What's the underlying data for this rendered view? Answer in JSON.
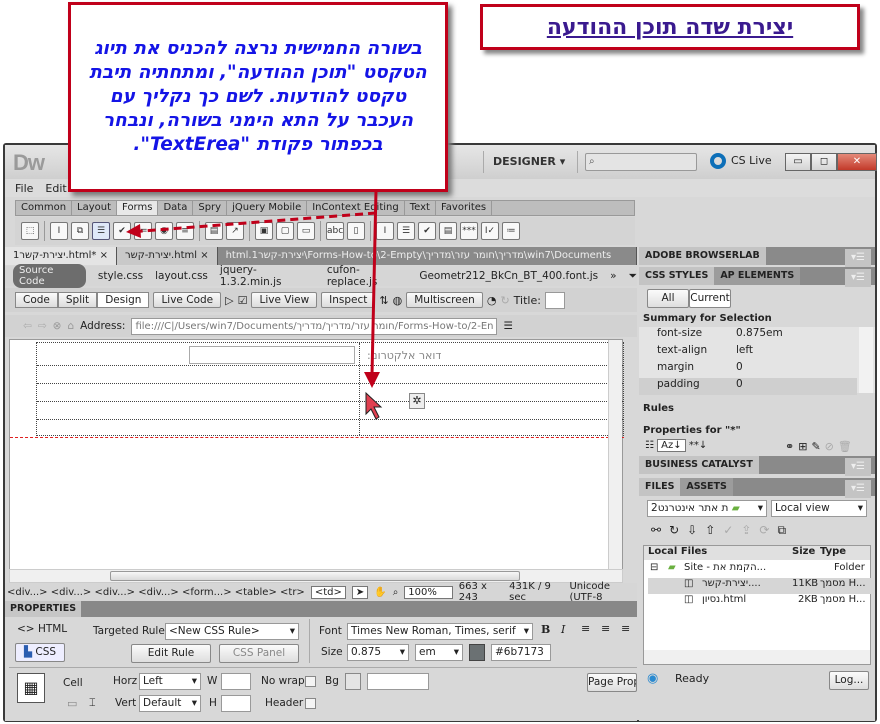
{
  "title_box": {
    "text": "יצירת שדה תוכן ההודעה"
  },
  "callout": {
    "text": "בשורה החמישית נרצה להכניס את תיוג הטקסט \"תוכן ההודעה\", ומתחתיה תיבת טקסט להודעות. לשם כך נקליך עם העכבר על התא הימני בשורה, ונבחר בכפתור פקודת \"TextErea\"."
  },
  "app": {
    "logo": "Dw",
    "workspace": "DESIGNER ▾",
    "cs_live": "CS Live",
    "menu": [
      "File",
      "Edit"
    ],
    "insert_tabs": [
      "Common",
      "Layout",
      "Forms",
      "Data",
      "Spry",
      "jQuery Mobile",
      "InContext Editing",
      "Text",
      "Favorites"
    ],
    "active_insert_tab": "Forms",
    "insert_icons": [
      "form-icon",
      "text-field-icon",
      "hidden-field-icon",
      "textarea-icon",
      "checkbox-icon",
      "radio-group-icon",
      "radio-button-icon",
      "list-menu-icon",
      "jump-menu-icon",
      "image-field-icon",
      "file-field-icon",
      "button-icon",
      "label-icon",
      "fieldset-icon",
      "spry-text-field-icon",
      "spry-textarea-icon",
      "spry-checkbox-icon",
      "spry-select-icon",
      "spry-password-icon",
      "spry-confirm-icon",
      "spry-radio-icon"
    ],
    "doc_tabs": [
      {
        "label": "יצירת-קשר1.html*",
        "close": "×"
      },
      {
        "label": "יצירת-קשר.html",
        "close": "×"
      }
    ],
    "doc_path": "win7\\Documents\\מדריך\\חומר עזר\\מדריך\\Forms-How-to\\2-Empty\\יצירת-קשר1.html",
    "related_files": {
      "source": "Source Code",
      "files": [
        "style.css",
        "layout.css",
        "jquery-1.3.2.min.js",
        "cufon-replace.js",
        "Geometr212_BkCn_BT_400.font.js"
      ]
    },
    "doc_toolbar": {
      "views": [
        "Code",
        "Split",
        "Design"
      ],
      "active_view": "Design",
      "live_code": "Live Code",
      "live_view": "Live View",
      "inspect": "Inspect",
      "multiscreen": "Multiscreen",
      "title_label": "Title:"
    },
    "address": {
      "label": "Address:",
      "value": "file:///C|/Users/win7/Documents/חומר עזר/מדריך/מדריך/Forms-How-to/2-En"
    },
    "design_view": {
      "email_label": "דואר אלקטרוני:"
    },
    "status_bar": {
      "tag_selector": "<div...> <div...> <div...> <div...> <form...> <table> <tr>",
      "selected_tag": "<td>",
      "zoom": "100%",
      "size": "663 x 243",
      "download": "431K / 9 sec",
      "encoding": "Unicode (UTF-8"
    },
    "properties": {
      "header": "PROPERTIES",
      "html_label": "HTML",
      "css_label": "CSS",
      "targeted_rule_label": "Targeted Rule",
      "targeted_rule": "<New CSS Rule>",
      "edit_rule": "Edit Rule",
      "css_panel": "CSS Panel",
      "font_label": "Font",
      "font": "Times New Roman, Times, serif",
      "size_label": "Size",
      "size": "0.875",
      "unit": "em",
      "color": "#6b7173",
      "cell_label": "Cell",
      "horz_label": "Horz",
      "horz": "Left",
      "vert_label": "Vert",
      "vert": "Default",
      "w_label": "W",
      "h_label": "H",
      "nowrap_label": "No wrap",
      "header_label": "Header",
      "bg_label": "Bg",
      "page_props": "Page Prope"
    },
    "panels": {
      "browserlab": "ADOBE BROWSERLAB",
      "css_tabs": [
        "CSS STYLES",
        "AP ELEMENTS"
      ],
      "mode_buttons": [
        "All",
        "Current"
      ],
      "summary_title": "Summary for Selection",
      "summary": [
        {
          "prop": "font-size",
          "value": "0.875em"
        },
        {
          "prop": "text-align",
          "value": "left"
        },
        {
          "prop": "margin",
          "value": "0"
        },
        {
          "prop": "padding",
          "value": "0"
        }
      ],
      "rules": "Rules",
      "properties_for": "Properties for \"*\"",
      "business_catalyst": "BUSINESS CATALYST",
      "files_tabs": [
        "FILES",
        "ASSETS"
      ],
      "site": "ת אתר אינטרנט2",
      "view": "Local view",
      "columns": [
        "Local Files",
        "Size",
        "Type"
      ],
      "files": [
        {
          "name": "Site - הקמת את...",
          "size": "",
          "type": "Folder"
        },
        {
          "name": "יצירת-קשר....",
          "size": "11KB",
          "type": "מסמך H..."
        },
        {
          "name": "נסיון.html",
          "size": "2KB",
          "type": "מסמך H..."
        }
      ],
      "status": "Ready",
      "log": "Log..."
    }
  }
}
